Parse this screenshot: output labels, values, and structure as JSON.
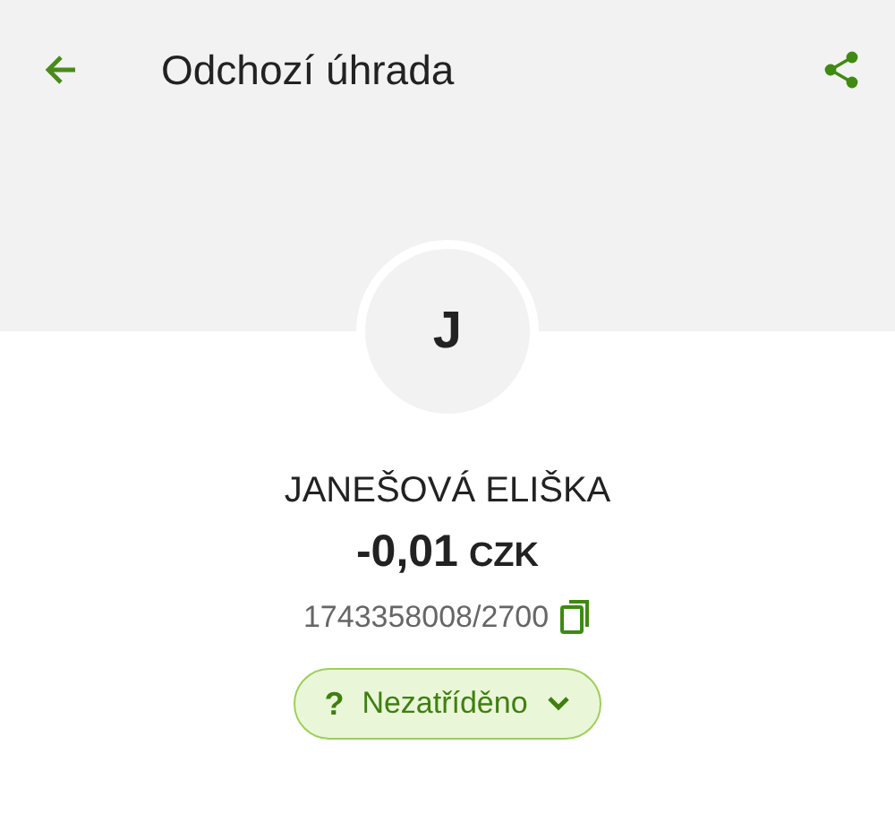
{
  "top_bar": {
    "title": "Odchozí úhrada"
  },
  "avatar": {
    "initial": "J"
  },
  "payee": {
    "name": "JANEŠOVÁ ELIŠKA"
  },
  "amount": {
    "value": "-0,01",
    "currency": "CZK"
  },
  "account": {
    "number": "1743358008/2700"
  },
  "category": {
    "icon": "?",
    "label": "Nezatříděno"
  }
}
